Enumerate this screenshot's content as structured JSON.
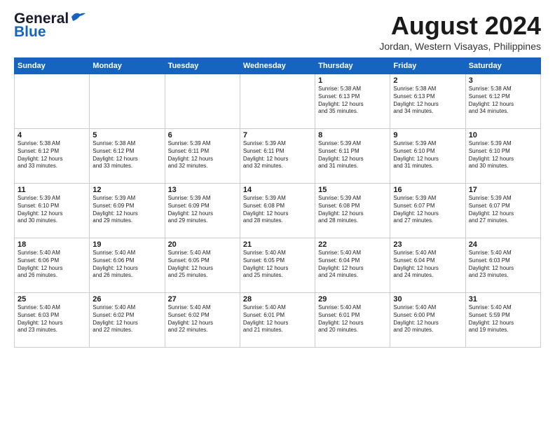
{
  "header": {
    "logo_line1": "General",
    "logo_line2": "Blue",
    "month_year": "August 2024",
    "location": "Jordan, Western Visayas, Philippines"
  },
  "days_of_week": [
    "Sunday",
    "Monday",
    "Tuesday",
    "Wednesday",
    "Thursday",
    "Friday",
    "Saturday"
  ],
  "weeks": [
    [
      {
        "day": "",
        "info": ""
      },
      {
        "day": "",
        "info": ""
      },
      {
        "day": "",
        "info": ""
      },
      {
        "day": "",
        "info": ""
      },
      {
        "day": "1",
        "info": "Sunrise: 5:38 AM\nSunset: 6:13 PM\nDaylight: 12 hours\nand 35 minutes."
      },
      {
        "day": "2",
        "info": "Sunrise: 5:38 AM\nSunset: 6:13 PM\nDaylight: 12 hours\nand 34 minutes."
      },
      {
        "day": "3",
        "info": "Sunrise: 5:38 AM\nSunset: 6:12 PM\nDaylight: 12 hours\nand 34 minutes."
      }
    ],
    [
      {
        "day": "4",
        "info": "Sunrise: 5:38 AM\nSunset: 6:12 PM\nDaylight: 12 hours\nand 33 minutes."
      },
      {
        "day": "5",
        "info": "Sunrise: 5:38 AM\nSunset: 6:12 PM\nDaylight: 12 hours\nand 33 minutes."
      },
      {
        "day": "6",
        "info": "Sunrise: 5:39 AM\nSunset: 6:11 PM\nDaylight: 12 hours\nand 32 minutes."
      },
      {
        "day": "7",
        "info": "Sunrise: 5:39 AM\nSunset: 6:11 PM\nDaylight: 12 hours\nand 32 minutes."
      },
      {
        "day": "8",
        "info": "Sunrise: 5:39 AM\nSunset: 6:11 PM\nDaylight: 12 hours\nand 31 minutes."
      },
      {
        "day": "9",
        "info": "Sunrise: 5:39 AM\nSunset: 6:10 PM\nDaylight: 12 hours\nand 31 minutes."
      },
      {
        "day": "10",
        "info": "Sunrise: 5:39 AM\nSunset: 6:10 PM\nDaylight: 12 hours\nand 30 minutes."
      }
    ],
    [
      {
        "day": "11",
        "info": "Sunrise: 5:39 AM\nSunset: 6:10 PM\nDaylight: 12 hours\nand 30 minutes."
      },
      {
        "day": "12",
        "info": "Sunrise: 5:39 AM\nSunset: 6:09 PM\nDaylight: 12 hours\nand 29 minutes."
      },
      {
        "day": "13",
        "info": "Sunrise: 5:39 AM\nSunset: 6:09 PM\nDaylight: 12 hours\nand 29 minutes."
      },
      {
        "day": "14",
        "info": "Sunrise: 5:39 AM\nSunset: 6:08 PM\nDaylight: 12 hours\nand 28 minutes."
      },
      {
        "day": "15",
        "info": "Sunrise: 5:39 AM\nSunset: 6:08 PM\nDaylight: 12 hours\nand 28 minutes."
      },
      {
        "day": "16",
        "info": "Sunrise: 5:39 AM\nSunset: 6:07 PM\nDaylight: 12 hours\nand 27 minutes."
      },
      {
        "day": "17",
        "info": "Sunrise: 5:39 AM\nSunset: 6:07 PM\nDaylight: 12 hours\nand 27 minutes."
      }
    ],
    [
      {
        "day": "18",
        "info": "Sunrise: 5:40 AM\nSunset: 6:06 PM\nDaylight: 12 hours\nand 26 minutes."
      },
      {
        "day": "19",
        "info": "Sunrise: 5:40 AM\nSunset: 6:06 PM\nDaylight: 12 hours\nand 26 minutes."
      },
      {
        "day": "20",
        "info": "Sunrise: 5:40 AM\nSunset: 6:05 PM\nDaylight: 12 hours\nand 25 minutes."
      },
      {
        "day": "21",
        "info": "Sunrise: 5:40 AM\nSunset: 6:05 PM\nDaylight: 12 hours\nand 25 minutes."
      },
      {
        "day": "22",
        "info": "Sunrise: 5:40 AM\nSunset: 6:04 PM\nDaylight: 12 hours\nand 24 minutes."
      },
      {
        "day": "23",
        "info": "Sunrise: 5:40 AM\nSunset: 6:04 PM\nDaylight: 12 hours\nand 24 minutes."
      },
      {
        "day": "24",
        "info": "Sunrise: 5:40 AM\nSunset: 6:03 PM\nDaylight: 12 hours\nand 23 minutes."
      }
    ],
    [
      {
        "day": "25",
        "info": "Sunrise: 5:40 AM\nSunset: 6:03 PM\nDaylight: 12 hours\nand 23 minutes."
      },
      {
        "day": "26",
        "info": "Sunrise: 5:40 AM\nSunset: 6:02 PM\nDaylight: 12 hours\nand 22 minutes."
      },
      {
        "day": "27",
        "info": "Sunrise: 5:40 AM\nSunset: 6:02 PM\nDaylight: 12 hours\nand 22 minutes."
      },
      {
        "day": "28",
        "info": "Sunrise: 5:40 AM\nSunset: 6:01 PM\nDaylight: 12 hours\nand 21 minutes."
      },
      {
        "day": "29",
        "info": "Sunrise: 5:40 AM\nSunset: 6:01 PM\nDaylight: 12 hours\nand 20 minutes."
      },
      {
        "day": "30",
        "info": "Sunrise: 5:40 AM\nSunset: 6:00 PM\nDaylight: 12 hours\nand 20 minutes."
      },
      {
        "day": "31",
        "info": "Sunrise: 5:40 AM\nSunset: 5:59 PM\nDaylight: 12 hours\nand 19 minutes."
      }
    ]
  ]
}
